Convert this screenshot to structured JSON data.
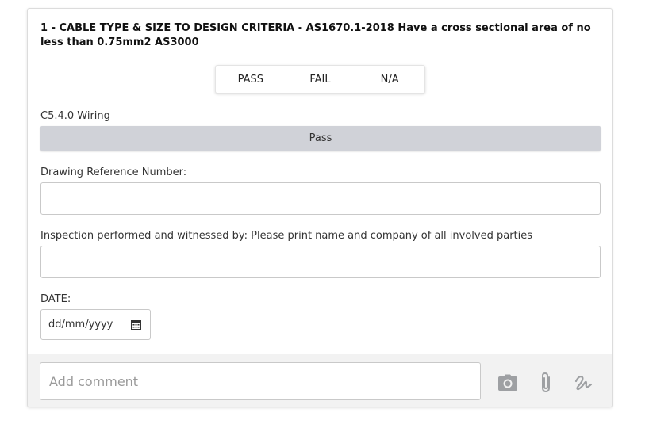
{
  "question": {
    "title": "1 - CABLE TYPE & SIZE TO DESIGN CRITERIA - AS1670.1-2018 Have a cross sectional area of no less than 0.75mm2 AS3000"
  },
  "result_options": {
    "pass": "PASS",
    "fail": "FAIL",
    "na": "N/A"
  },
  "section": {
    "label": "C5.4.0 Wiring",
    "value": "Pass"
  },
  "drawing_reference": {
    "label": "Drawing Reference Number:",
    "value": ""
  },
  "inspection": {
    "label": "Inspection performed and witnessed by: Please print name and company of all involved parties",
    "value": ""
  },
  "date": {
    "label": "DATE:",
    "placeholder": "dd/mm/yyyy"
  },
  "comment": {
    "placeholder": "Add comment"
  },
  "icons": {
    "calendar": "calendar-icon",
    "camera": "camera-icon",
    "attach": "paperclip-icon",
    "signature": "signature-icon"
  },
  "colors": {
    "section_bar": "#d0d2d8",
    "footer_bg": "#f2f2f2",
    "icon": "#9ea0a3"
  }
}
